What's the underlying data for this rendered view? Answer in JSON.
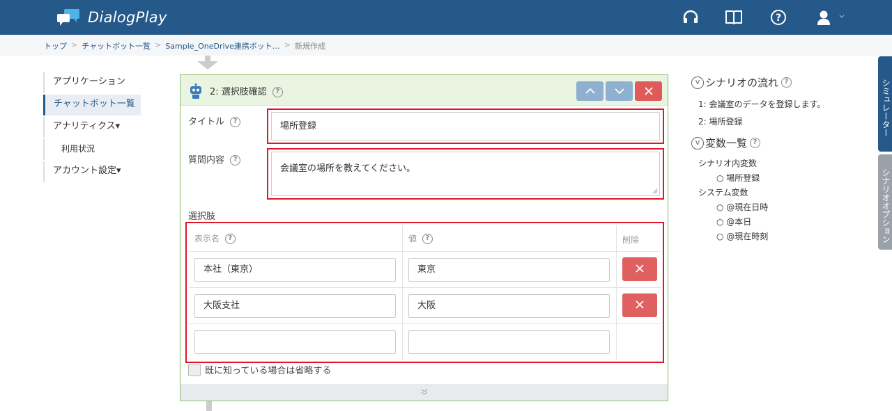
{
  "header": {
    "app_name": "DialogPlay",
    "icons": [
      "headset-icon",
      "book-icon",
      "help-icon",
      "user-icon"
    ]
  },
  "breadcrumb": {
    "items": [
      "トップ",
      "チャットボット一覧",
      "Sample_OneDrive連携ボット…",
      "新規作成"
    ]
  },
  "leftnav": {
    "items": [
      {
        "label": "アプリケーション"
      },
      {
        "label": "チャットボット一覧"
      },
      {
        "label": "アナリティクス▾"
      },
      {
        "label": "利用状況"
      },
      {
        "label": "アカウント設定▾"
      }
    ]
  },
  "panel": {
    "title": "2: 選択肢確認",
    "title_label": "タイトル",
    "title_value": "場所登録",
    "question_label": "質問内容",
    "question_value": "会議室の場所を教えてください。",
    "choices_label": "選択肢",
    "columns": [
      "表示名",
      "値",
      "削除"
    ],
    "rows": [
      {
        "display": "本社（東京）",
        "value": "東京"
      },
      {
        "display": "大阪支社",
        "value": "大阪"
      },
      {
        "display": "",
        "value": ""
      }
    ],
    "skip_label": "既に知っている場合は省略する",
    "footer": "≫"
  },
  "right": {
    "flow_title": "シナリオの流れ",
    "flow_items": [
      "1: 会議室のデータを登録します。",
      "2: 場所登録"
    ],
    "vars_title": "変数一覧",
    "scenario_vars_title": "シナリオ内変数",
    "scenario_vars": [
      "場所登録"
    ],
    "system_vars_title": "システム変数",
    "system_vars": [
      "@現在日時",
      "@本日",
      "@現在時刻"
    ]
  },
  "tabs": {
    "simulator": "シミュレーター",
    "options": "シナリオオプション"
  }
}
